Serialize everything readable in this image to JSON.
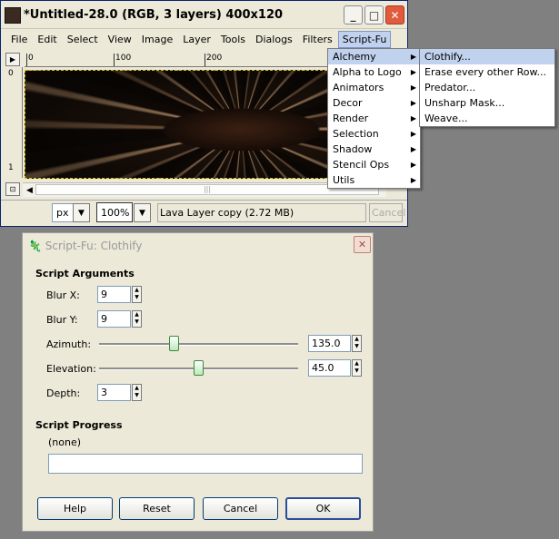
{
  "window": {
    "title": "*Untitled-28.0 (RGB, 3 layers) 400x120",
    "controls": {
      "minimize": "_",
      "maximize": "□",
      "close": "✕"
    }
  },
  "menubar": [
    {
      "label": "File"
    },
    {
      "label": "Edit"
    },
    {
      "label": "Select"
    },
    {
      "label": "View"
    },
    {
      "label": "Image"
    },
    {
      "label": "Layer"
    },
    {
      "label": "Tools"
    },
    {
      "label": "Dialogs"
    },
    {
      "label": "Filters"
    },
    {
      "label": "Script-Fu"
    }
  ],
  "ruler": {
    "top_labels": [
      "0",
      "100",
      "200"
    ],
    "left_labels": [
      "0",
      "1"
    ]
  },
  "statusbar": {
    "unit": "px",
    "zoom": "100%",
    "layer_info": "Lava Layer copy (2.72 MB)",
    "cancel": "Cancel"
  },
  "scriptfu_menu": [
    {
      "label": "Alchemy"
    },
    {
      "label": "Alpha to Logo"
    },
    {
      "label": "Animators"
    },
    {
      "label": "Decor"
    },
    {
      "label": "Render"
    },
    {
      "label": "Selection"
    },
    {
      "label": "Shadow"
    },
    {
      "label": "Stencil Ops"
    },
    {
      "label": "Utils"
    }
  ],
  "alchemy_menu": [
    {
      "label": "Clothify..."
    },
    {
      "label": "Erase every other Row..."
    },
    {
      "label": "Predator..."
    },
    {
      "label": "Unsharp Mask..."
    },
    {
      "label": "Weave..."
    }
  ],
  "dialog": {
    "title": "Script-Fu: Clothify",
    "args_title": "Script Arguments",
    "blur_x": {
      "label": "Blur X:",
      "value": "9"
    },
    "blur_y": {
      "label": "Blur Y:",
      "value": "9"
    },
    "azimuth": {
      "label": "Azimuth:",
      "value": "135.0",
      "min": 0,
      "max": 360,
      "level": 135.0
    },
    "elevation": {
      "label": "Elevation:",
      "value": "45.0",
      "min": 0.5,
      "max": 90,
      "level": 45.0
    },
    "depth": {
      "label": "Depth:",
      "value": "3"
    },
    "progress_title": "Script Progress",
    "progress_status": "(none)",
    "buttons": {
      "help": "Help",
      "reset": "Reset",
      "cancel": "Cancel",
      "ok": "OK"
    }
  }
}
